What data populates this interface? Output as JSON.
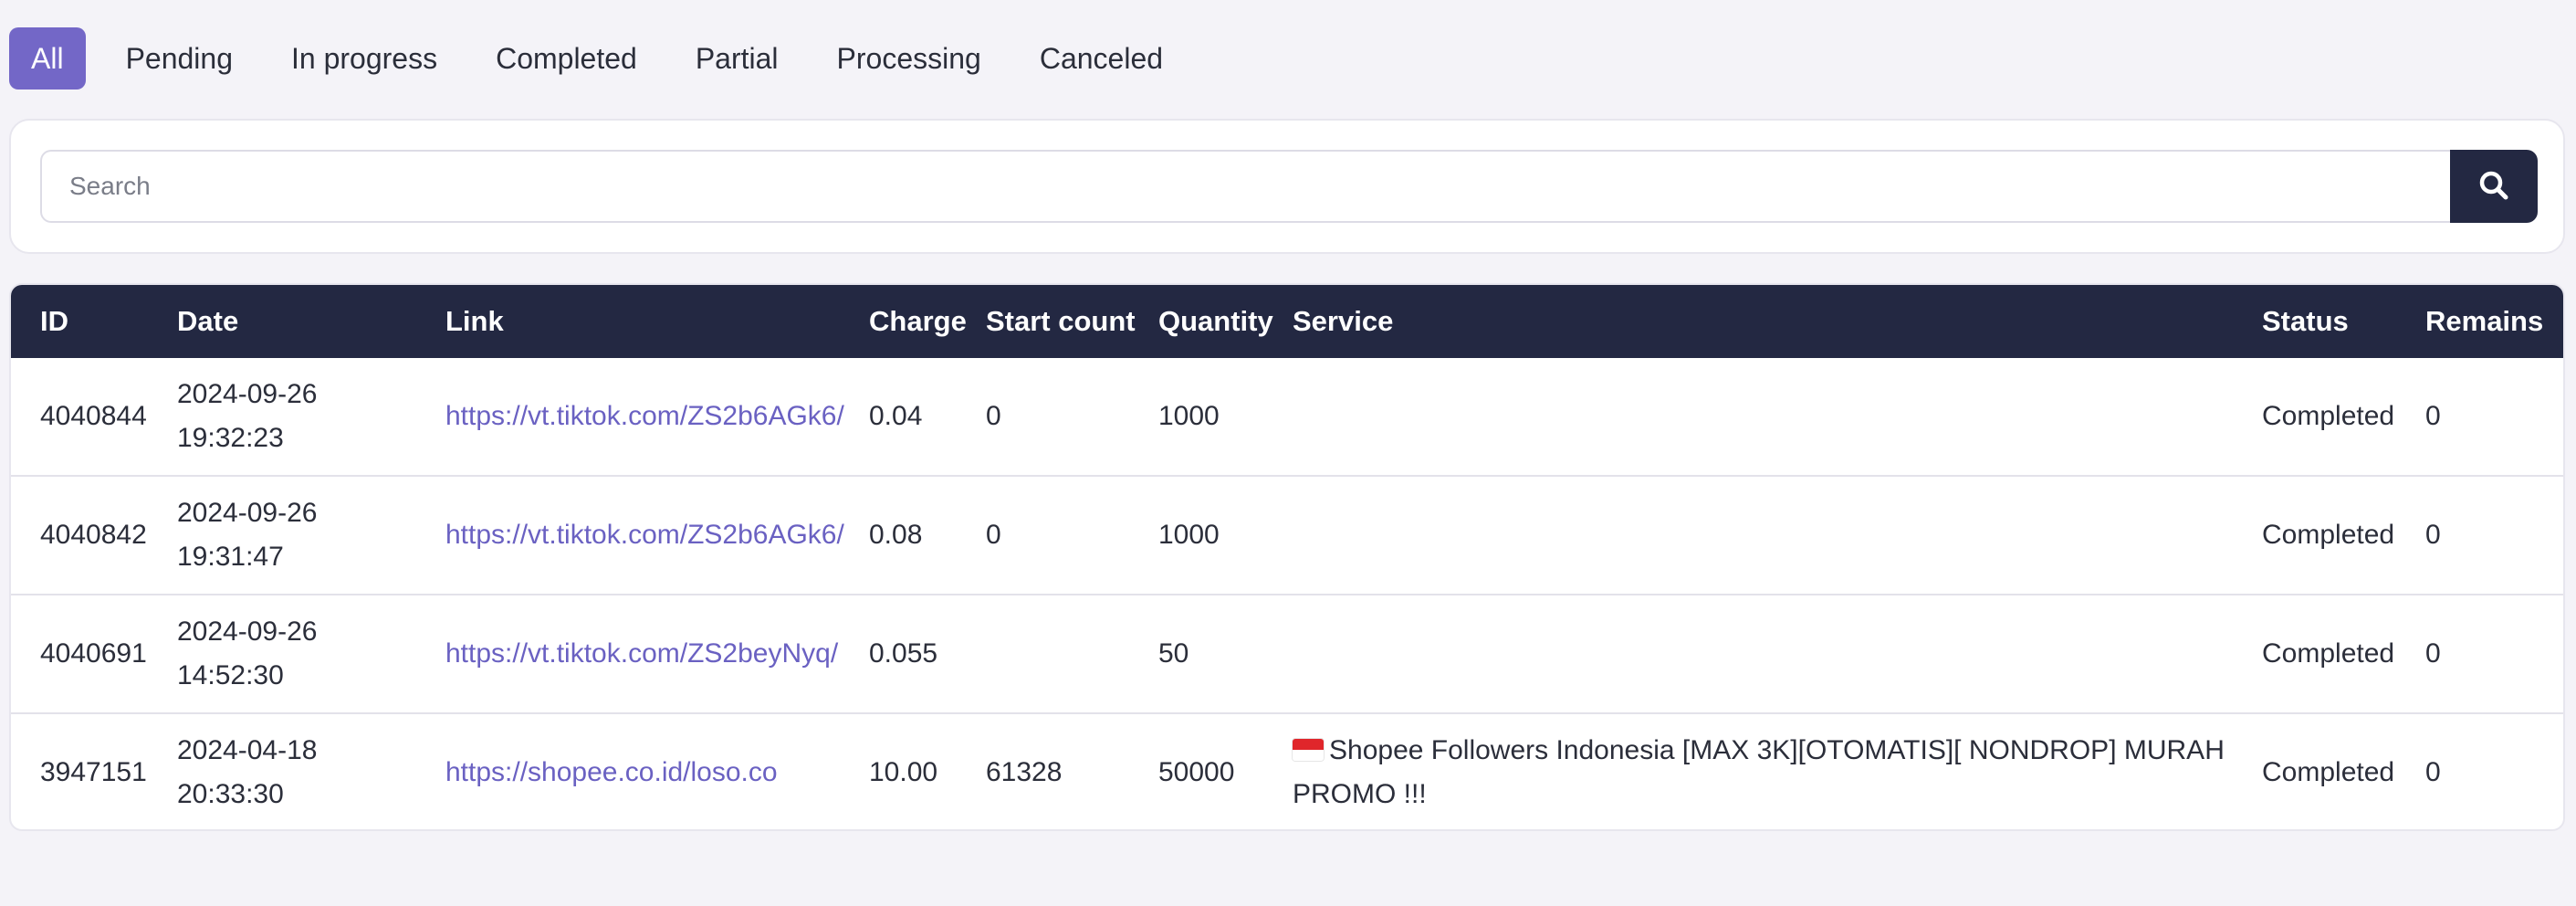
{
  "tabs": [
    {
      "label": "All",
      "active": true
    },
    {
      "label": "Pending"
    },
    {
      "label": "In progress"
    },
    {
      "label": "Completed"
    },
    {
      "label": "Partial"
    },
    {
      "label": "Processing"
    },
    {
      "label": "Canceled"
    }
  ],
  "search": {
    "placeholder": "Search",
    "value": "",
    "button_icon": "search-icon"
  },
  "table": {
    "headers": {
      "id": "ID",
      "date": "Date",
      "link": "Link",
      "charge": "Charge",
      "start_count": "Start count",
      "quantity": "Quantity",
      "service": "Service",
      "status": "Status",
      "remains": "Remains"
    },
    "rows": [
      {
        "id": "4040844",
        "date": "2024-09-26",
        "time": "19:32:23",
        "link": "https://vt.tiktok.com/ZS2b6AGk6/",
        "charge": "0.04",
        "start_count": "0",
        "quantity": "1000",
        "service": "",
        "status": "Completed",
        "remains": "0"
      },
      {
        "id": "4040842",
        "date": "2024-09-26",
        "time": "19:31:47",
        "link": "https://vt.tiktok.com/ZS2b6AGk6/",
        "charge": "0.08",
        "start_count": "0",
        "quantity": "1000",
        "service": "",
        "status": "Completed",
        "remains": "0"
      },
      {
        "id": "4040691",
        "date": "2024-09-26",
        "time": "14:52:30",
        "link": "https://vt.tiktok.com/ZS2beyNyq/",
        "charge": "0.055",
        "start_count": "",
        "quantity": "50",
        "service": "",
        "status": "Completed",
        "remains": "0"
      },
      {
        "id": "3947151",
        "date": "2024-04-18",
        "time": "20:33:30",
        "link": "https://shopee.co.id/loso.co",
        "charge": "10.00",
        "start_count": "61328",
        "quantity": "50000",
        "service_icon": "indonesia-flag-icon",
        "service": "Shopee Followers Indonesia [MAX 3K][OTOMATIS][ NONDROP] MURAH PROMO !!!",
        "status": "Completed",
        "remains": "0"
      }
    ]
  },
  "colors": {
    "accent": "#7367c7",
    "header_bg": "#232842",
    "link": "#6a61c2",
    "page_bg": "#f4f3f8"
  }
}
